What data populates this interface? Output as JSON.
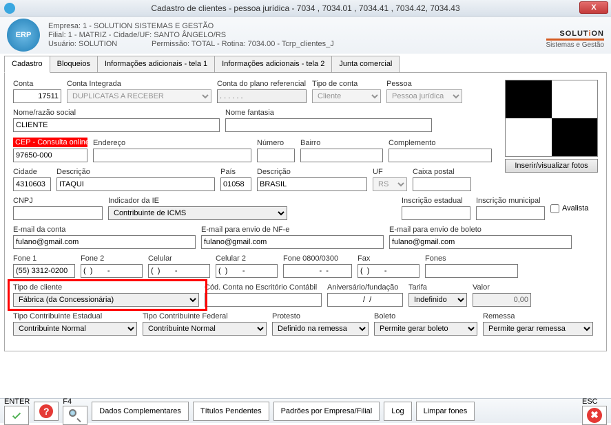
{
  "window": {
    "title": "Cadastro de clientes - pessoa jurídica - 7034 , 7034.01 , 7034.41 , 7034.42, 7034.43",
    "close": "X"
  },
  "header": {
    "empresa": "Empresa: 1 - SOLUTION SISTEMAS E GESTÃO",
    "filial": "Filial: 1 - MATRIZ - Cidade/UF: SANTO ÂNGELO/RS",
    "usuario": "Usuário: SOLUTION",
    "permissao": "Permissão: TOTAL - Rotina: 7034.00 - Tcrp_clientes_J",
    "brand": "SOLUT",
    "brand_i": "i",
    "brand2": "ON",
    "sub": "Sistemas e Gestão",
    "erp": "ERP"
  },
  "tabs": {
    "t0": "Cadastro",
    "t1": "Bloqueios",
    "t2": "Informações adicionais - tela 1",
    "t3": "Informações adicionais - tela 2",
    "t4": "Junta comercial"
  },
  "labels": {
    "conta": "Conta",
    "conta_integrada": "Conta Integrada",
    "conta_plano": "Conta do plano referencial",
    "tipo_conta": "Tipo de conta",
    "pessoa": "Pessoa",
    "nome": "Nome/razão social",
    "fantasia": "Nome fantasia",
    "cep": "CEP - Consulta online",
    "endereco": "Endereço",
    "numero": "Número",
    "bairro": "Bairro",
    "complemento": "Complemento",
    "cidade": "Cidade",
    "descricao": "Descrição",
    "pais": "País",
    "descricao2": "Descrição",
    "uf": "UF",
    "caixa_postal": "Caixa postal",
    "cnpj": "CNPJ",
    "indicador_ie": "Indicador da IE",
    "inscricao_estadual": "Inscrição estadual",
    "inscricao_municipal": "Inscrição municipal",
    "avalista": "Avalista",
    "email_conta": "E-mail da conta",
    "email_nfe": "E-mail para envio de NF-e",
    "email_boleto": "E-mail para envio de boleto",
    "fone1": "Fone 1",
    "fone2": "Fone 2",
    "celular": "Celular",
    "celular2": "Celular 2",
    "fone0800": "Fone 0800/0300",
    "fax": "Fax",
    "fones": "Fones",
    "tipo_cliente": "Tipo de cliente",
    "cod_conta_escritorio": "Cód. Conta no Escritório Contábil",
    "aniversario": "Aniversário/fundação",
    "tarifa": "Tarifa",
    "valor": "Valor",
    "tipo_contrib_est": "Tipo Contribuinte Estadual",
    "tipo_contrib_fed": "Tipo Contribuinte Federal",
    "protesto": "Protesto",
    "boleto": "Boleto",
    "remessa": "Remessa",
    "photo_btn": "Inserir/visualizar fotos"
  },
  "values": {
    "conta": "17511",
    "conta_integrada": "DUPLICATAS A RECEBER",
    "conta_plano": ". . . . . .",
    "tipo_conta": "Cliente",
    "pessoa": "Pessoa jurídica",
    "nome": "CLIENTE",
    "fantasia": "",
    "cep": "97650-000",
    "endereco": "",
    "numero": "",
    "bairro": "",
    "complemento": "",
    "cidade": "4310603",
    "descricao": "ITAQUI",
    "pais": "01058",
    "descricao2": "BRASIL",
    "uf": "RS",
    "caixa_postal": "",
    "cnpj": "",
    "indicador_ie": "Contribuinte de ICMS",
    "inscricao_estadual": "",
    "inscricao_municipal": "",
    "email_conta": "fulano@gmail.com",
    "email_nfe": "fulano@gmail.com",
    "email_boleto": "fulano@gmail.com",
    "fone1": "(55) 3312-0200",
    "fone2": "(  )       -",
    "celular": "(  )       -",
    "celular2": "(  )       -",
    "fone0800": "      -  -",
    "fax": "(  )       -",
    "fones": "",
    "tipo_cliente": "Fábrica (da Concessionária)",
    "cod_conta_escritorio": "",
    "aniversario": "  /  /",
    "tarifa": "Indefinido",
    "valor": "0,00",
    "tipo_contrib_est": "Contribuinte Normal",
    "tipo_contrib_fed": "Contribuinte Normal",
    "protesto": "Definido na remessa",
    "boleto": "Permite gerar boleto",
    "remessa": "Permite gerar remessa"
  },
  "bottom": {
    "enter": "ENTER",
    "f4": "F4",
    "dados_complementares": "Dados Complementares",
    "titulos_pendentes": "Títulos Pendentes",
    "padroes": "Padrões por Empresa/Filial",
    "log": "Log",
    "limpar_fones": "Limpar fones",
    "esc": "ESC"
  }
}
